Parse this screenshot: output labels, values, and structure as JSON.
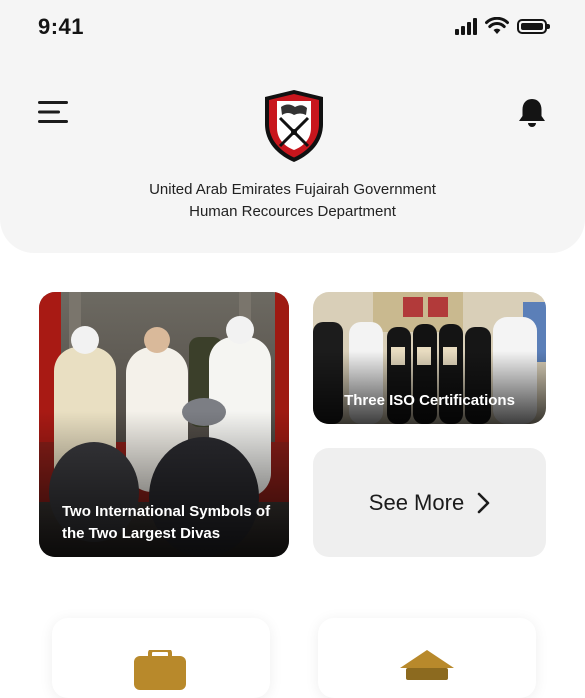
{
  "status_bar": {
    "time": "9:41",
    "icons": [
      "signal-icon",
      "wifi-icon",
      "battery-icon"
    ]
  },
  "header": {
    "icons": [
      "hamburger-menu-icon",
      "fujairah-emblem-logo",
      "bell-icon"
    ],
    "org_line_1": "United Arab Emirates Fujairah Government",
    "org_line_2": "Human Recources Department"
  },
  "news": [
    {
      "caption": "Two International Symbols of the Two Largest Divas"
    },
    {
      "caption": "Three ISO Certifications"
    }
  ],
  "see_more": {
    "label": "See More",
    "icon": "chevron-right-icon"
  },
  "services": [
    {
      "icon": "briefcase-icon"
    },
    {
      "icon": "military-cap-icon"
    }
  ],
  "colors": {
    "header_bg": "#f5f5f5",
    "logo_red": "#c8161d",
    "accent_gold": "#b8892b",
    "card_bg": "#efefef"
  }
}
